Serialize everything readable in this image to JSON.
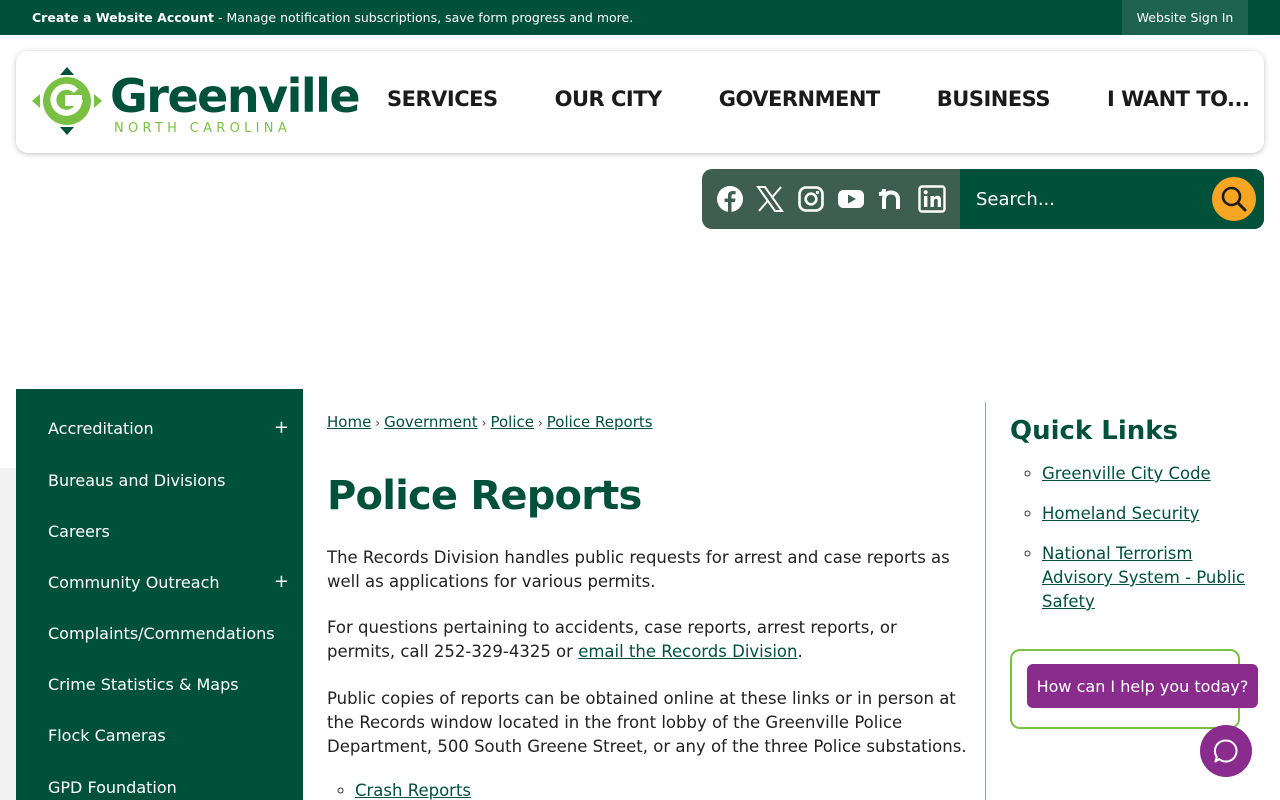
{
  "topbar": {
    "account_link": "Create a Website Account",
    "account_text": " - Manage notification subscriptions, save form progress and more.",
    "signin": "Website Sign In"
  },
  "logo": {
    "name": "Greenville",
    "subtitle": "NORTH CAROLINA"
  },
  "nav": {
    "items": [
      "SERVICES",
      "OUR CITY",
      "GOVERNMENT",
      "BUSINESS",
      "I WANT TO..."
    ]
  },
  "social": {
    "icons": [
      "facebook-icon",
      "x-icon",
      "instagram-icon",
      "youtube-icon",
      "nextdoor-icon",
      "linkedin-icon"
    ]
  },
  "search": {
    "placeholder": "Search..."
  },
  "sidebar": {
    "items": [
      {
        "label": "Accreditation",
        "expand": "+"
      },
      {
        "label": "Bureaus and Divisions",
        "expand": ""
      },
      {
        "label": "Careers",
        "expand": ""
      },
      {
        "label": "Community Outreach",
        "expand": "+"
      },
      {
        "label": "Complaints/Commendations",
        "expand": ""
      },
      {
        "label": "Crime Statistics & Maps",
        "expand": ""
      },
      {
        "label": "Flock Cameras",
        "expand": ""
      },
      {
        "label": "GPD Foundation",
        "expand": ""
      }
    ]
  },
  "breadcrumb": [
    "Home",
    "Government",
    "Police",
    "Police Reports"
  ],
  "page": {
    "title": "Police Reports",
    "p1": "The Records Division handles public requests for arrest and case reports as well as applications for various permits.",
    "p2_before": "For questions pertaining to accidents, case reports, arrest reports, or permits, call 252-329-4325 or ",
    "p2_link": "email the Records Division",
    "p2_after": ".",
    "p3": "Public copies of reports can be obtained online at these links or in person at the Records window located in the front lobby of the Greenville Police Department, 500 South Greene Street, or any of the three Police substations.",
    "links": [
      "Crash Reports"
    ]
  },
  "quick_links": {
    "title": "Quick Links",
    "items": [
      "Greenville City Code",
      "Homeland Security",
      "National Terrorism Advisory System - Public Safety"
    ]
  },
  "chat": {
    "prompt": "How can I help you today?"
  },
  "colors": {
    "primary": "#00513a",
    "accent": "#7ac143",
    "search_button": "#f6a623",
    "chat": "#8a2c8d"
  }
}
